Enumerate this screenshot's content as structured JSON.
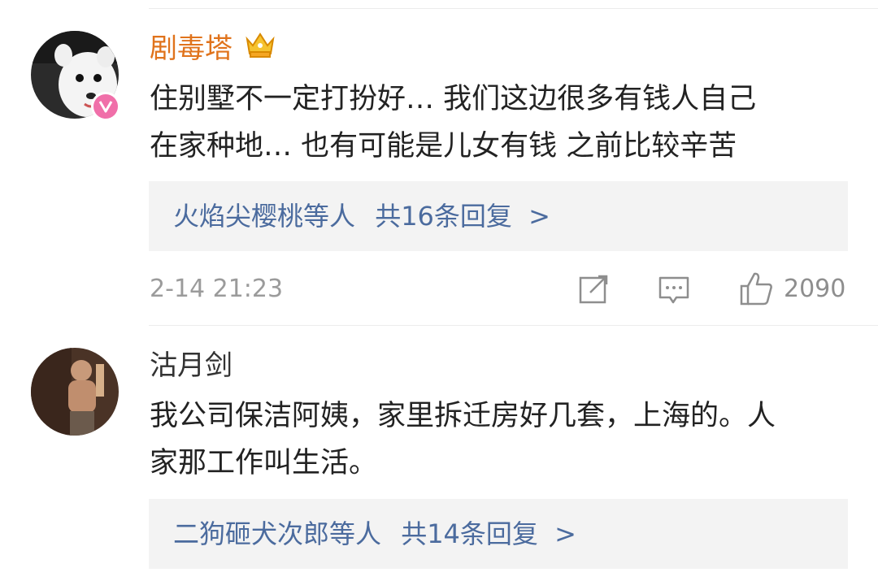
{
  "comments": [
    {
      "username": "剧毒塔",
      "text_lines": [
        "住别墅不一定打扮好… 我们这边很多有钱人自己",
        "在家种地… 也有可能是儿女有钱 之前比较辛苦"
      ],
      "replies": {
        "names": "火焰尖樱桃等人",
        "summary": "共16条回复",
        "arrow": ">"
      },
      "timestamp": "2-14 21:23",
      "likes": "2090",
      "username_color": "#e0731c",
      "icons": [
        "forward-icon",
        "comment-icon",
        "like-icon"
      ]
    },
    {
      "username": "沽月剑",
      "text_lines": [
        "我公司保洁阿姨，家里拆迁房好几套，上海的。人",
        "家那工作叫生活。"
      ],
      "replies": {
        "names": "二狗砸犬次郎等人",
        "summary": "共14条回复",
        "arrow": ">"
      },
      "username_color": "#333333"
    }
  ]
}
